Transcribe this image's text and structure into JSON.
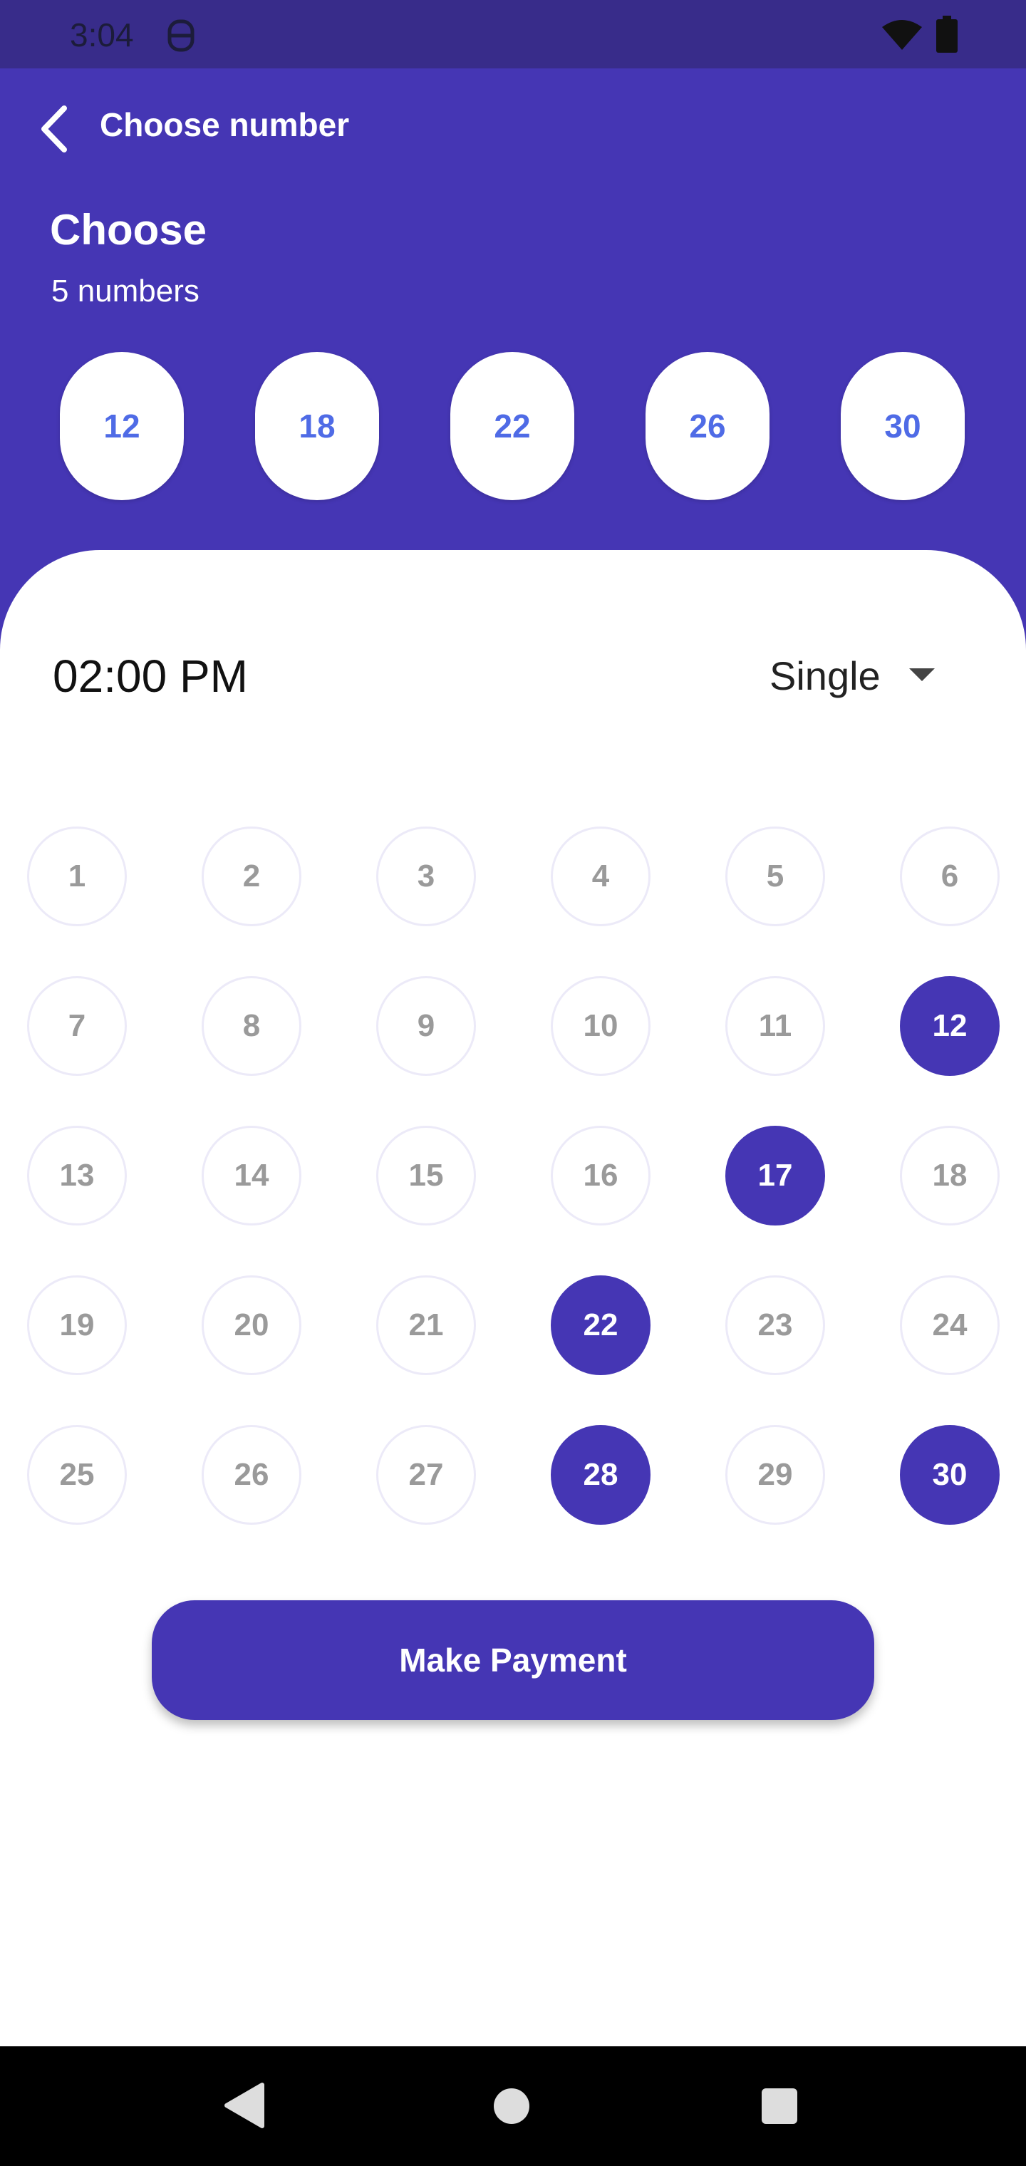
{
  "status_bar": {
    "time": "3:04",
    "icons": [
      "notification-icon",
      "wifi-icon",
      "battery-icon"
    ]
  },
  "header": {
    "title": "Choose number",
    "heading": "Choose",
    "subheading": "5 numbers",
    "picked_numbers": [
      "12",
      "18",
      "22",
      "26",
      "30"
    ]
  },
  "sheet": {
    "time": "02:00 PM",
    "mode": {
      "selected": "Single"
    },
    "numbers": [
      {
        "label": "1",
        "selected": false
      },
      {
        "label": "2",
        "selected": false
      },
      {
        "label": "3",
        "selected": false
      },
      {
        "label": "4",
        "selected": false
      },
      {
        "label": "5",
        "selected": false
      },
      {
        "label": "6",
        "selected": false
      },
      {
        "label": "7",
        "selected": false
      },
      {
        "label": "8",
        "selected": false
      },
      {
        "label": "9",
        "selected": false
      },
      {
        "label": "10",
        "selected": false
      },
      {
        "label": "11",
        "selected": false
      },
      {
        "label": "12",
        "selected": true
      },
      {
        "label": "13",
        "selected": false
      },
      {
        "label": "14",
        "selected": false
      },
      {
        "label": "15",
        "selected": false
      },
      {
        "label": "16",
        "selected": false
      },
      {
        "label": "17",
        "selected": true
      },
      {
        "label": "18",
        "selected": false
      },
      {
        "label": "19",
        "selected": false
      },
      {
        "label": "20",
        "selected": false
      },
      {
        "label": "21",
        "selected": false
      },
      {
        "label": "22",
        "selected": true
      },
      {
        "label": "23",
        "selected": false
      },
      {
        "label": "24",
        "selected": false
      },
      {
        "label": "25",
        "selected": false
      },
      {
        "label": "26",
        "selected": false
      },
      {
        "label": "27",
        "selected": false
      },
      {
        "label": "28",
        "selected": true
      },
      {
        "label": "29",
        "selected": false
      },
      {
        "label": "30",
        "selected": true
      }
    ],
    "pay_button": "Make Payment"
  },
  "colors": {
    "primary": "#4536B4",
    "status_bar": "#382C8A",
    "chip_text": "#4F6BE6",
    "unselected_text": "#9A9A9A"
  },
  "nav_bar": {
    "icons": [
      "nav-back-icon",
      "nav-home-icon",
      "nav-recents-icon"
    ]
  }
}
